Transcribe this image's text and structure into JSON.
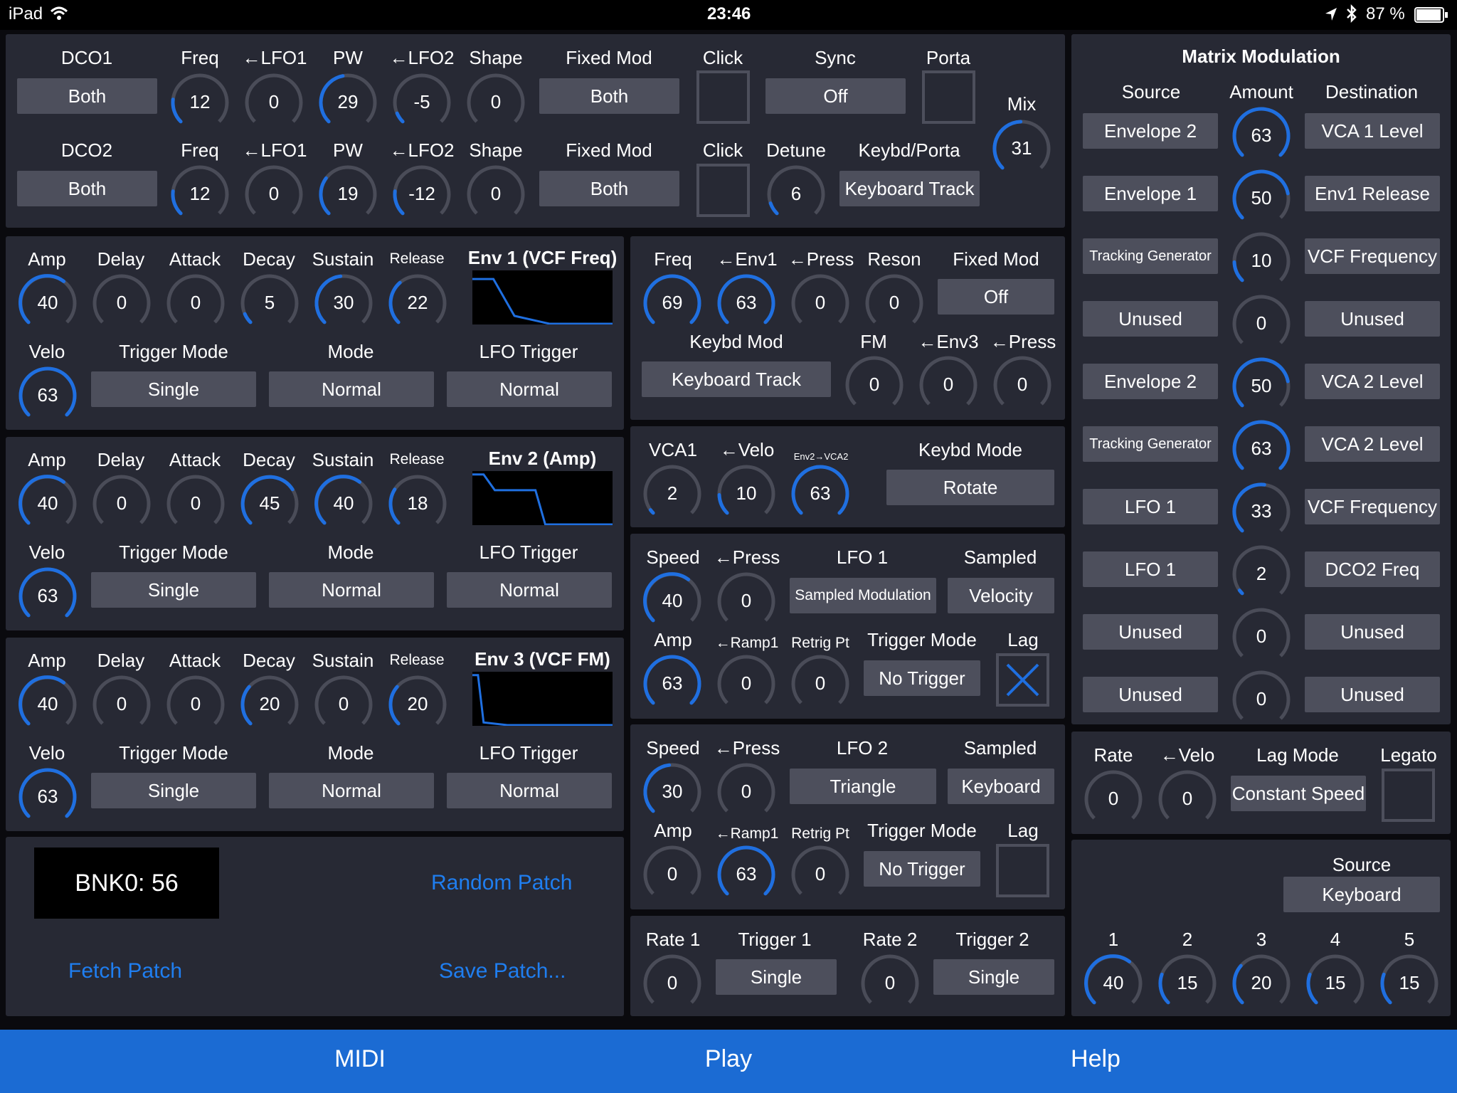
{
  "status": {
    "device": "iPad",
    "time": "23:46",
    "battery": "87 %"
  },
  "top": {
    "dco1": "DCO1",
    "dco2": "DCO2",
    "freq": "Freq",
    "lfo1": "←LFO1",
    "pw": "PW",
    "lfo2": "←LFO2",
    "shape": "Shape",
    "fixed_mod": "Fixed Mod",
    "click": "Click",
    "sync": "Sync",
    "porta": "Porta",
    "detune": "Detune",
    "keybd_porta": "Keybd/Porta",
    "mix": "Mix",
    "dco1_mode": "Both",
    "dco1_fixed": "Both",
    "sync_value": "Off",
    "dco2_mode": "Both",
    "dco2_fixed": "Both",
    "dco2_keybd": "Keyboard Track",
    "dco1_vals": [
      "12",
      "0",
      "29",
      "-5",
      "0"
    ],
    "dco2_vals": [
      "12",
      "0",
      "19",
      "-12",
      "0"
    ],
    "detune_val": "6",
    "mix_val": "31"
  },
  "env_labels": {
    "amp": "Amp",
    "delay": "Delay",
    "attack": "Attack",
    "decay": "Decay",
    "sustain": "Sustain",
    "release": "Release",
    "velo": "Velo",
    "trigger_mode": "Trigger Mode",
    "mode": "Mode",
    "lfo_trigger": "LFO Trigger"
  },
  "env1": {
    "title": "Env 1 (VCF Freq)",
    "vals": [
      "40",
      "0",
      "0",
      "5",
      "30",
      "22"
    ],
    "velo": "63",
    "trigger": "Single",
    "mode": "Normal",
    "lfo": "Normal"
  },
  "env2": {
    "title": "Env 2 (Amp)",
    "vals": [
      "40",
      "0",
      "0",
      "45",
      "40",
      "18"
    ],
    "velo": "63",
    "trigger": "Single",
    "mode": "Normal",
    "lfo": "Normal"
  },
  "env3": {
    "title": "Env 3 (VCF FM)",
    "vals": [
      "40",
      "0",
      "0",
      "20",
      "0",
      "20"
    ],
    "velo": "63",
    "trigger": "Single",
    "mode": "Normal",
    "lfo": "Normal"
  },
  "vcf": {
    "freq": "Freq",
    "env1": "←Env1",
    "press": "←Press",
    "reson": "Reson",
    "fixed_mod": "Fixed Mod",
    "fixed_val": "Off",
    "keybd_mod": "Keybd Mod",
    "keybd_val": "Keyboard Track",
    "fm": "FM",
    "env3": "←Env3",
    "press2": "←Press",
    "vals": [
      "69",
      "63",
      "0",
      "0"
    ],
    "vals2": [
      "0",
      "0",
      "0"
    ]
  },
  "vca": {
    "vca1": "VCA1",
    "velo": "←Velo",
    "env2vca2": "Env2→VCA2",
    "keybd_mode": "Keybd Mode",
    "keybd_val": "Rotate",
    "vals": [
      "2",
      "10",
      "63"
    ]
  },
  "lfo1": {
    "speed": "Speed",
    "press": "←Press",
    "title": "LFO 1",
    "sampled": "Sampled",
    "wave": "Sampled Modulation",
    "sampled_val": "Velocity",
    "amp": "Amp",
    "ramp": "←Ramp1",
    "retrig": "Retrig Pt",
    "trigger_mode": "Trigger Mode",
    "trigger_val": "No Trigger",
    "lag": "Lag",
    "vals": [
      "40",
      "0",
      "63",
      "0",
      "0"
    ]
  },
  "lfo2": {
    "speed": "Speed",
    "press": "←Press",
    "title": "LFO 2",
    "sampled": "Sampled",
    "wave": "Triangle",
    "sampled_val": "Keyboard",
    "amp": "Amp",
    "ramp": "←Ramp1",
    "retrig": "Retrig Pt",
    "trigger_mode": "Trigger Mode",
    "trigger_val": "No Trigger",
    "lag": "Lag",
    "vals": [
      "30",
      "0",
      "0",
      "63",
      "0"
    ]
  },
  "ramp": {
    "rate1": "Rate 1",
    "trig1": "Trigger 1",
    "rate2": "Rate 2",
    "trig2": "Trigger 2",
    "trig1_val": "Single",
    "trig2_val": "Single",
    "vals": [
      "0",
      "0"
    ]
  },
  "patch": {
    "display": "BNK0: 56",
    "random": "Random Patch",
    "fetch": "Fetch Patch",
    "save": "Save Patch..."
  },
  "matrix": {
    "title": "Matrix Modulation",
    "source": "Source",
    "amount": "Amount",
    "destination": "Destination",
    "rows": [
      {
        "src": "Envelope 2",
        "amt": "63",
        "dst": "VCA 1 Level"
      },
      {
        "src": "Envelope 1",
        "amt": "50",
        "dst": "Env1 Release"
      },
      {
        "src": "Tracking Generator",
        "amt": "10",
        "dst": "VCF Frequency"
      },
      {
        "src": "Unused",
        "amt": "0",
        "dst": "Unused"
      },
      {
        "src": "Envelope 2",
        "amt": "50",
        "dst": "VCA 2 Level"
      },
      {
        "src": "Tracking Generator",
        "amt": "63",
        "dst": "VCA 2 Level"
      },
      {
        "src": "LFO 1",
        "amt": "33",
        "dst": "VCF Frequency"
      },
      {
        "src": "LFO 1",
        "amt": "2",
        "dst": "DCO2 Freq"
      },
      {
        "src": "Unused",
        "amt": "0",
        "dst": "Unused"
      },
      {
        "src": "Unused",
        "amt": "0",
        "dst": "Unused"
      }
    ]
  },
  "portamento": {
    "rate": "Rate",
    "velo": "←Velo",
    "lag_mode": "Lag Mode",
    "legato": "Legato",
    "lag_val": "Constant Speed",
    "vals": [
      "0",
      "0"
    ]
  },
  "tracking": {
    "source": "Source",
    "source_val": "Keyboard",
    "points": [
      "1",
      "2",
      "3",
      "4",
      "5"
    ],
    "vals": [
      "40",
      "15",
      "20",
      "15",
      "15"
    ]
  },
  "tabs": {
    "midi": "MIDI",
    "play": "Play",
    "help": "Help"
  },
  "colors": {
    "accent": "#1f6fe0",
    "panel": "#272934",
    "button": "#4d4f5c",
    "tabbar": "#1b6bd3",
    "link": "#1f7ef0"
  }
}
